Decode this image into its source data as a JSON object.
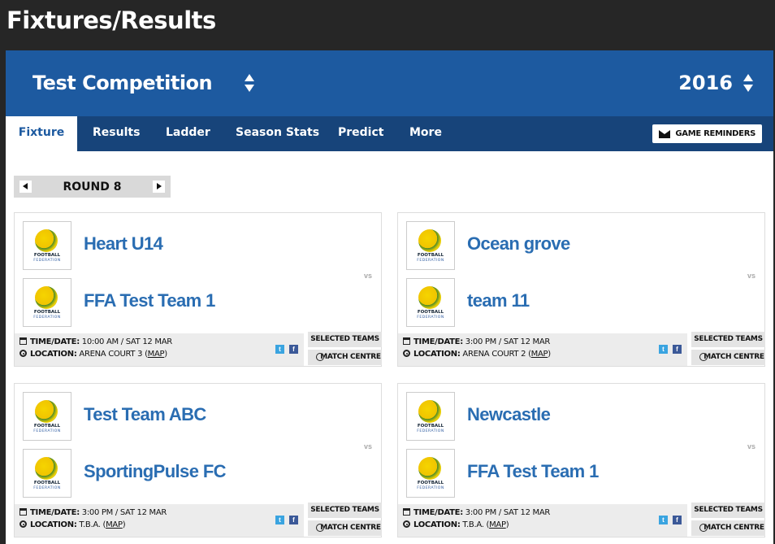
{
  "page": {
    "title": "Fixtures/Results"
  },
  "competition": {
    "name": "Test Competition",
    "year": "2016"
  },
  "tabs": [
    {
      "label": "Fixture",
      "active": true
    },
    {
      "label": "Results"
    },
    {
      "label": "Ladder"
    },
    {
      "label": "Season Stats"
    },
    {
      "label": "Predict"
    },
    {
      "label": "More"
    }
  ],
  "reminders_label": "GAME REMINDERS",
  "round": {
    "label": "ROUND 8"
  },
  "logo_text": {
    "line1": "FOOTBALL",
    "line2": "FEDERATION"
  },
  "labels": {
    "vs": "vs",
    "time": "TIME/DATE:",
    "location": "LOCATION:",
    "map": "MAP",
    "selected_teams": "SELECTED TEAMS",
    "match_centre": "MATCH CENTRE",
    "twitter": "t",
    "facebook": "f"
  },
  "matches": [
    {
      "home": "Heart U14",
      "away": "FFA Test Team 1",
      "time": "10:00 AM / SAT 12 MAR",
      "location": "ARENA COURT 3"
    },
    {
      "home": "Ocean grove",
      "away": "team 11",
      "time": "3:00 PM / SAT 12 MAR",
      "location": "ARENA COURT 2"
    },
    {
      "home": "Test Team ABC",
      "away": "SportingPulse FC",
      "time": "3:00 PM / SAT 12 MAR",
      "location": "T.B.A."
    },
    {
      "home": "Newcastle",
      "away": "FFA Test Team 1",
      "time": "3:00 PM / SAT 12 MAR",
      "location": "T.B.A."
    }
  ],
  "colors": {
    "header_blue": "#1d5aa0",
    "tab_bar": "#17447a",
    "team_link": "#2a6db2",
    "page_bg": "#262626"
  }
}
